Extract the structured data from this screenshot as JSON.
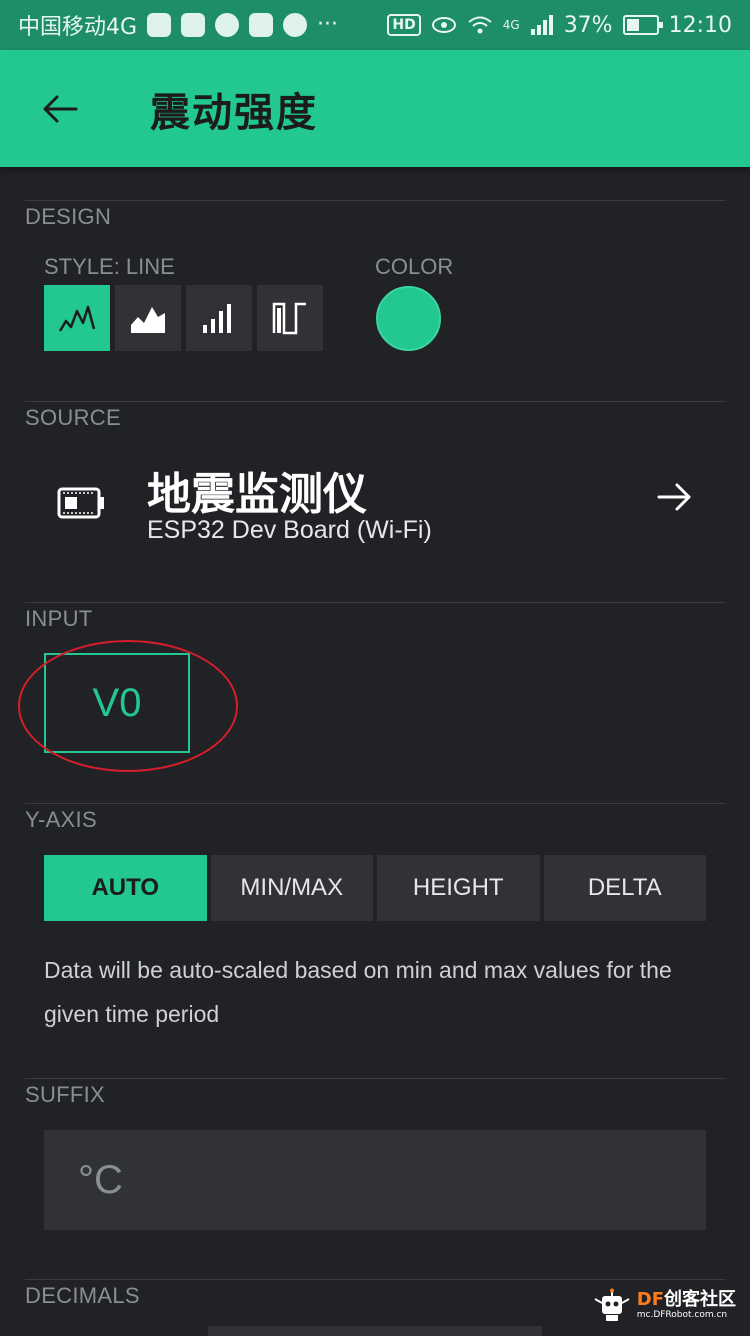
{
  "status_bar": {
    "carrier": "中国移动4G",
    "dots": "···",
    "hd": "HD",
    "network": "4G",
    "battery_percent": "37%",
    "time": "12:10"
  },
  "app_bar": {
    "title": "震动强度",
    "back_icon": "arrow-left-icon"
  },
  "design": {
    "label": "DESIGN",
    "style_label": "STYLE: LINE",
    "color_label": "COLOR",
    "styles": [
      {
        "icon": "line-chart-icon",
        "active": true
      },
      {
        "icon": "area-chart-icon",
        "active": false
      },
      {
        "icon": "bar-chart-icon",
        "active": false
      },
      {
        "icon": "binary-chart-icon",
        "active": false
      }
    ],
    "color": "#23c790"
  },
  "source": {
    "label": "SOURCE",
    "device_name": "地震监测仪",
    "device_type": "ESP32 Dev Board (Wi-Fi)"
  },
  "input": {
    "label": "INPUT",
    "pin": "V0"
  },
  "y_axis": {
    "label": "Y-AXIS",
    "tabs": [
      {
        "label": "AUTO",
        "active": true
      },
      {
        "label": "MIN/MAX",
        "active": false
      },
      {
        "label": "HEIGHT",
        "active": false
      },
      {
        "label": "DELTA",
        "active": false
      }
    ],
    "description": "Data will be auto-scaled based on min and max values for the given time period"
  },
  "suffix": {
    "label": "SUFFIX",
    "value": "°C"
  },
  "decimals": {
    "label": "DECIMALS"
  },
  "watermark": {
    "brand_prefix": "DF",
    "brand_rest": "创客社区",
    "url": "mc.DFRobot.com.cn"
  },
  "colors": {
    "accent": "#23c790",
    "background": "#212225",
    "button": "#303236",
    "annotation": "#d61e2a"
  }
}
